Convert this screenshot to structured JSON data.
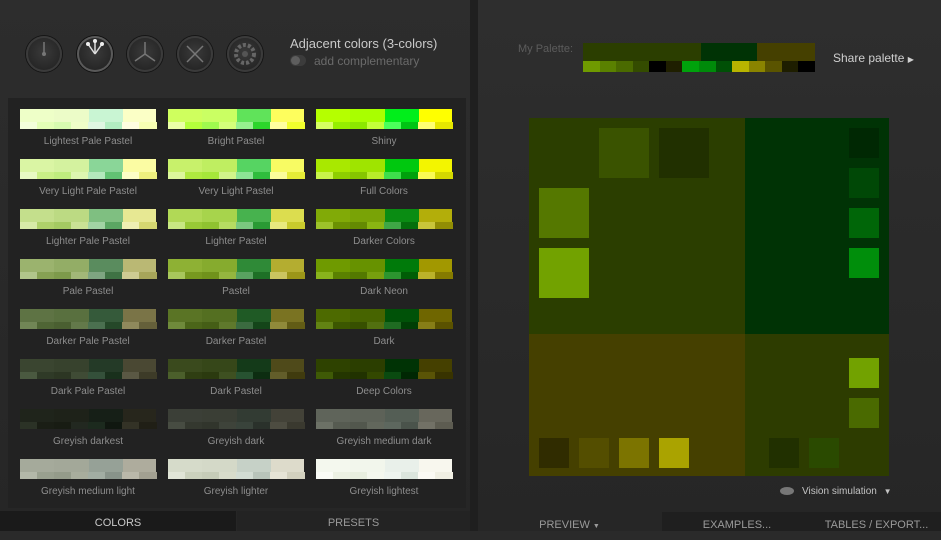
{
  "header": {
    "scheme_title": "Adjacent colors (3-colors)",
    "complementary_label": "add complementary"
  },
  "scheme_icons": [
    "mono-scheme-icon",
    "adjacent-scheme-icon",
    "triad-scheme-icon",
    "tetrad-scheme-icon",
    "freestyle-scheme-icon"
  ],
  "variants": [
    {
      "label": "Lightest Pale Pastel",
      "main": [
        "#eeffc8",
        "#ecfcc8",
        "#c9f5d3",
        "#fbffc6"
      ],
      "sub": [
        "#f3ffdb",
        "#e3ffb6",
        "#d7fbb0",
        "#effec8",
        "#dff7e2",
        "#b2edc1",
        "#fffde0",
        "#f7ffb3"
      ]
    },
    {
      "label": "Bright Pastel",
      "main": [
        "#cfff5e",
        "#caff63",
        "#60e35a",
        "#fefe5d"
      ],
      "sub": [
        "#eaffa7",
        "#b4ff3b",
        "#9ffa4e",
        "#d4ff7a",
        "#96f08f",
        "#2cd52b",
        "#ffffa0",
        "#f1ff2c"
      ]
    },
    {
      "label": "Shiny",
      "main": [
        "#b5ff00",
        "#a9ff00",
        "#01ee1b",
        "#ffff00"
      ],
      "sub": [
        "#d6ff62",
        "#96ee00",
        "#8ce700",
        "#c3ff3a",
        "#4bff5b",
        "#00c414",
        "#ffff72",
        "#e6e700"
      ]
    },
    {
      "label": "Very Light Pale Pastel",
      "main": [
        "#daf5a4",
        "#d4f29f",
        "#8ad698",
        "#fbfca3"
      ],
      "sub": [
        "#e8fac4",
        "#c9ef86",
        "#bfec7e",
        "#ddf6b0",
        "#b3e8bc",
        "#62c273",
        "#fdfdc6",
        "#eef07e"
      ]
    },
    {
      "label": "Very Light Pastel",
      "main": [
        "#c8f16b",
        "#bfee61",
        "#56d462",
        "#f8fb63"
      ],
      "sub": [
        "#dcf79c",
        "#afe93f",
        "#a6e73a",
        "#d1f48a",
        "#8ce495",
        "#2fbd3d",
        "#fcfd9b",
        "#e6ec36"
      ]
    },
    {
      "label": "Full Colors",
      "main": [
        "#a9e800",
        "#9fe400",
        "#00c80f",
        "#f3f500"
      ],
      "sub": [
        "#c8f44a",
        "#8ecf00",
        "#86c500",
        "#b8ec2a",
        "#3ede4c",
        "#00a00c",
        "#fafa55",
        "#d4d800"
      ]
    },
    {
      "label": "Lighter Pale Pastel",
      "main": [
        "#c4df8c",
        "#bcda83",
        "#7fbf81",
        "#e7e893"
      ],
      "sub": [
        "#d7eaa8",
        "#aed06a",
        "#a4ca62",
        "#cae295",
        "#a2d3a4",
        "#5ba663",
        "#efefb3",
        "#d5d771"
      ]
    },
    {
      "label": "Lighter Pastel",
      "main": [
        "#b1d956",
        "#a7d44c",
        "#47b24e",
        "#dcdd4f"
      ],
      "sub": [
        "#c8e783",
        "#98c936",
        "#8fc230",
        "#b6dc62",
        "#7ac87f",
        "#2a9a34",
        "#e8e97f",
        "#c8ca2c"
      ]
    },
    {
      "label": "Darker Colors",
      "main": [
        "#81aa07",
        "#79a306",
        "#0a8c13",
        "#b3ae0a"
      ],
      "sub": [
        "#9dc22a",
        "#6b9102",
        "#648a02",
        "#8ab512",
        "#3fa746",
        "#056e0c",
        "#c9c53a",
        "#918d04"
      ]
    },
    {
      "label": "Pale Pastel",
      "main": [
        "#9bb36e",
        "#93ad66",
        "#5a8c5e",
        "#bab874"
      ],
      "sub": [
        "#b1c68b",
        "#86a153",
        "#7d9a4b",
        "#a2b878",
        "#7ea581",
        "#3f7244",
        "#cecb93",
        "#a7a55a"
      ]
    },
    {
      "label": "Pastel",
      "main": [
        "#8eb134",
        "#86ab2e",
        "#2f8a37",
        "#b4ad30"
      ],
      "sub": [
        "#a8c75c",
        "#77991f",
        "#70921b",
        "#95b63f",
        "#59a260",
        "#1e7026",
        "#cbc560",
        "#9c9618"
      ]
    },
    {
      "label": "Dark Neon",
      "main": [
        "#6f9a00",
        "#679200",
        "#007a0a",
        "#a29800"
      ],
      "sub": [
        "#89b31c",
        "#5a8100",
        "#537900",
        "#779f0e",
        "#2c952f",
        "#005d06",
        "#bbb22a",
        "#857b00"
      ]
    },
    {
      "label": "Darker Pale Pastel",
      "main": [
        "#5e7344",
        "#59703f",
        "#355a3a",
        "#7a7447"
      ],
      "sub": [
        "#718656",
        "#4f6535",
        "#4a5f31",
        "#63794a",
        "#4b7050",
        "#254829",
        "#8f895c",
        "#65603a"
      ]
    },
    {
      "label": "Darker Pastel",
      "main": [
        "#5a7425",
        "#546f21",
        "#1f5a25",
        "#7a7322"
      ],
      "sub": [
        "#6f8a3b",
        "#4b6519",
        "#455e16",
        "#5f792c",
        "#3b6b40",
        "#144519",
        "#908a3a",
        "#625c15"
      ]
    },
    {
      "label": "Dark",
      "main": [
        "#4d6a00",
        "#476400",
        "#005208",
        "#6f6600"
      ],
      "sub": [
        "#628313",
        "#3c5700",
        "#375000",
        "#527010",
        "#1f6b22",
        "#003e05",
        "#877e17",
        "#5a5200"
      ]
    },
    {
      "label": "Dark Pale Pastel",
      "main": [
        "#3a4530",
        "#37422d",
        "#243a27",
        "#4a4833"
      ],
      "sub": [
        "#4a5940",
        "#2f3a27",
        "#2c3623",
        "#3f4b35",
        "#34503a",
        "#19301c",
        "#5a5844",
        "#3d3b28"
      ]
    },
    {
      "label": "Dark Pastel",
      "main": [
        "#3a4a1d",
        "#364719",
        "#143a19",
        "#4f4a1a"
      ],
      "sub": [
        "#4b5f2b",
        "#2f3e12",
        "#2b3a0f",
        "#3e5021",
        "#275231",
        "#0d2d11",
        "#625d2a",
        "#403b0e"
      ]
    },
    {
      "label": "Deep Colors",
      "main": [
        "#2e4200",
        "#2b3e00",
        "#003305",
        "#454000"
      ],
      "sub": [
        "#3f5a06",
        "#243600",
        "#213200",
        "#334800",
        "#0a4a10",
        "#002703",
        "#5a5406",
        "#383300"
      ]
    },
    {
      "label": "Greyish darkest",
      "main": [
        "#1f241b",
        "#1e2219",
        "#161f17",
        "#27261c"
      ],
      "sub": [
        "#2b3226",
        "#1a1e15",
        "#181c13",
        "#222820",
        "#1c2a1e",
        "#101710",
        "#333226",
        "#201f16"
      ]
    },
    {
      "label": "Greyish dark",
      "main": [
        "#3b3f37",
        "#3a3e35",
        "#323b33",
        "#434238"
      ],
      "sub": [
        "#474c42",
        "#34382f",
        "#31352c",
        "#3e433a",
        "#39433b",
        "#2a312b",
        "#4d4c41",
        "#3a392f"
      ]
    },
    {
      "label": "Greyish medium dark",
      "main": [
        "#5f645a",
        "#5d6258",
        "#545e55",
        "#68675c"
      ],
      "sub": [
        "#6c7166",
        "#565b51",
        "#52574d",
        "#62675c",
        "#5d675e",
        "#4a534b",
        "#727166",
        "#5d5c51"
      ]
    },
    {
      "label": "Greyish medium light",
      "main": [
        "#a5aa9b",
        "#a3a899",
        "#96a197",
        "#aeac9d"
      ],
      "sub": [
        "#b3b8a9",
        "#99a08f",
        "#949b8a",
        "#a8ad9d",
        "#a2ada3",
        "#88938a",
        "#bab8aa",
        "#a2a091"
      ]
    },
    {
      "label": "Greyish lighter",
      "main": [
        "#d6dbca",
        "#d4d9c8",
        "#c6d1c7",
        "#dddbcb"
      ],
      "sub": [
        "#e1e5d7",
        "#cbd1bd",
        "#c6ccb8",
        "#d8dccb",
        "#d2dcd3",
        "#b8c4ba",
        "#e6e4d6",
        "#d2d0be"
      ]
    },
    {
      "label": "Greyish lightest",
      "main": [
        "#f4f8ee",
        "#f2f6ec",
        "#e9f0ea",
        "#f8f7ee"
      ],
      "sub": [
        "#fafcf6",
        "#ecf1e3",
        "#e8eedf",
        "#f4f7ee",
        "#eef4ef",
        "#dbe5dd",
        "#fbfaf4",
        "#f0efe3"
      ]
    }
  ],
  "tabs": {
    "colors": "COLORS",
    "presets": "PRESETS"
  },
  "my_palette": {
    "label": "My Palette:",
    "main": [
      "#2b3e00",
      "#2b3e00",
      "#003305",
      "#454000"
    ],
    "sub": [
      "#6f9a00",
      "#5a8100",
      "#4a6a00",
      "#344c00",
      "#000000",
      "#1f1f00",
      "#00a20c",
      "#008a0a",
      "#005006",
      "#b8b400",
      "#8a8400",
      "#5a5400",
      "#1e1e00",
      "#000000"
    ],
    "share_label": "Share palette"
  },
  "preview": {
    "bg_primary": "#2b3e00",
    "bg_secondary": "#003305",
    "bg_tertiary": "#454000",
    "bg_mixed": "#2d3c00"
  },
  "bottom": {
    "vision": "Vision simulation",
    "preview_tab": "PREVIEW",
    "examples_tab": "EXAMPLES...",
    "tables_tab": "TABLES / EXPORT..."
  }
}
